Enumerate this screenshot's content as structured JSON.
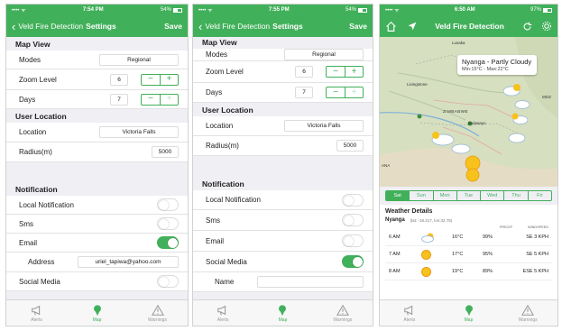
{
  "colors": {
    "accent": "#41b05a",
    "background": "#efeff4"
  },
  "tabs": [
    {
      "label": "Alerts",
      "icon": "megaphone-icon"
    },
    {
      "label": "Map",
      "icon": "map-pin-icon"
    },
    {
      "label": "Warnings",
      "icon": "warning-triangle-icon"
    }
  ],
  "screen1": {
    "status": {
      "time": "7:54 PM",
      "battery": "54%"
    },
    "nav": {
      "back": "Veld Fire Detection",
      "title": "Settings",
      "action": "Save"
    },
    "map_view": "Map View",
    "modes": {
      "label": "Modes",
      "value": "Regional"
    },
    "zoom": {
      "label": "Zoom Level",
      "value": "6"
    },
    "days": {
      "label": "Days",
      "value": "7"
    },
    "user_location": "User Location",
    "location": {
      "label": "Location",
      "value": "Victoria Falls"
    },
    "radius": {
      "label": "Radius(m)",
      "value": "5000"
    },
    "notification": "Notification",
    "local_notification": "Local Notification",
    "sms": "Sms",
    "email": "Email",
    "address": {
      "label": "Address",
      "value": "uriel_tapiwa@yahoo.com"
    },
    "social_media": "Social Media"
  },
  "screen2": {
    "status": {
      "time": "7:55 PM",
      "battery": "54%"
    },
    "nav": {
      "back": "Veld Fire Detection",
      "title": "Settings",
      "action": "Save"
    },
    "map_view": "Map View",
    "modes": {
      "label": "Modes",
      "value": "Regional"
    },
    "zoom": {
      "label": "Zoom Level",
      "value": "6"
    },
    "days": {
      "label": "Days",
      "value": "7"
    },
    "user_location": "User Location",
    "location": {
      "label": "Location",
      "value": "Victoria Falls"
    },
    "radius": {
      "label": "Radius(m)",
      "value": "5000"
    },
    "notification": "Notification",
    "local_notification": "Local Notification",
    "sms": "Sms",
    "email": "Email",
    "social_media": "Social Media",
    "name": {
      "label": "Name",
      "value": ""
    }
  },
  "screen3": {
    "status": {
      "time": "6:50 AM",
      "battery": "97%"
    },
    "nav": {
      "title": "Veld Fire Detection"
    },
    "map_labels": {
      "lusaka": "Lusaka",
      "livingstone": "Livingstone",
      "zimbabwe": "ZIMBABWE",
      "bulawayo": "Bulawayo",
      "moz": "MOZ",
      "ana": "ANA"
    },
    "popup": {
      "title": "Nyanga - Partly Cloudy",
      "subtitle": "Min:15°C - Max:22°C"
    },
    "days": [
      "Sat",
      "Sun",
      "Mon",
      "Tue",
      "Wed",
      "Thu",
      "Fri"
    ],
    "weather_title": "Weather Details",
    "location_name": "Nyanga",
    "coords": "(lat: -18.217, lon:32.75)",
    "headers": {
      "precip": "PRECIP",
      "wind": "WINDSPEED"
    },
    "rows": [
      {
        "time": "6 AM",
        "temp": "16°C",
        "precip": "99%",
        "wind": "SE 3 KPH"
      },
      {
        "time": "7 AM",
        "temp": "17°C",
        "precip": "95%",
        "wind": "SE 5 KPH"
      },
      {
        "time": "8 AM",
        "temp": "19°C",
        "precip": "89%",
        "wind": "ESE 5 KPH"
      }
    ]
  }
}
